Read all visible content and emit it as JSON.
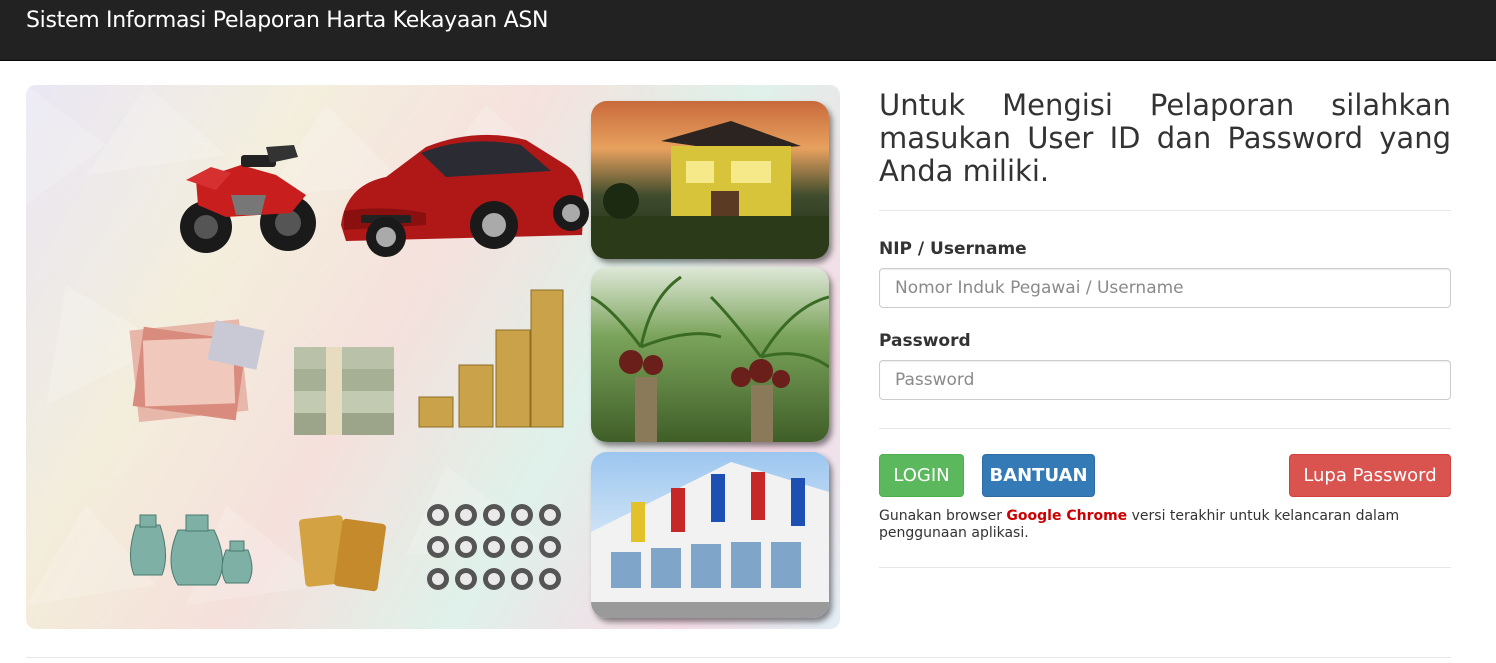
{
  "navbar": {
    "brand": "Sistem Informasi Pelaporan Harta Kekayaan ASN"
  },
  "hero": {
    "items": [
      "motorcycle",
      "car",
      "house",
      "banknotes-rupiah",
      "banknotes-dollar",
      "gold-coins",
      "palm-plantation",
      "vases",
      "gold-bars",
      "watches",
      "shophouse-building"
    ]
  },
  "login": {
    "heading": "Untuk Mengisi Pelaporan silahkan masukan User ID dan Password yang Anda miliki.",
    "username_label": "NIP / Username",
    "username_placeholder": "Nomor Induk Pegawai / Username",
    "username_value": "",
    "password_label": "Password",
    "password_placeholder": "Password",
    "password_value": "",
    "login_button": "LOGIN",
    "help_button": "BANTUAN",
    "forgot_button": "Lupa Password",
    "note_prefix": "Gunakan browser ",
    "note_browser": "Google Chrome",
    "note_suffix": " versi terakhir untuk kelancaran dalam penggunaan aplikasi."
  },
  "colors": {
    "navbar": "#222222",
    "login": "#5cb85c",
    "help": "#337ab7",
    "forgot": "#d9534f",
    "browser_highlight": "#cc0000"
  }
}
